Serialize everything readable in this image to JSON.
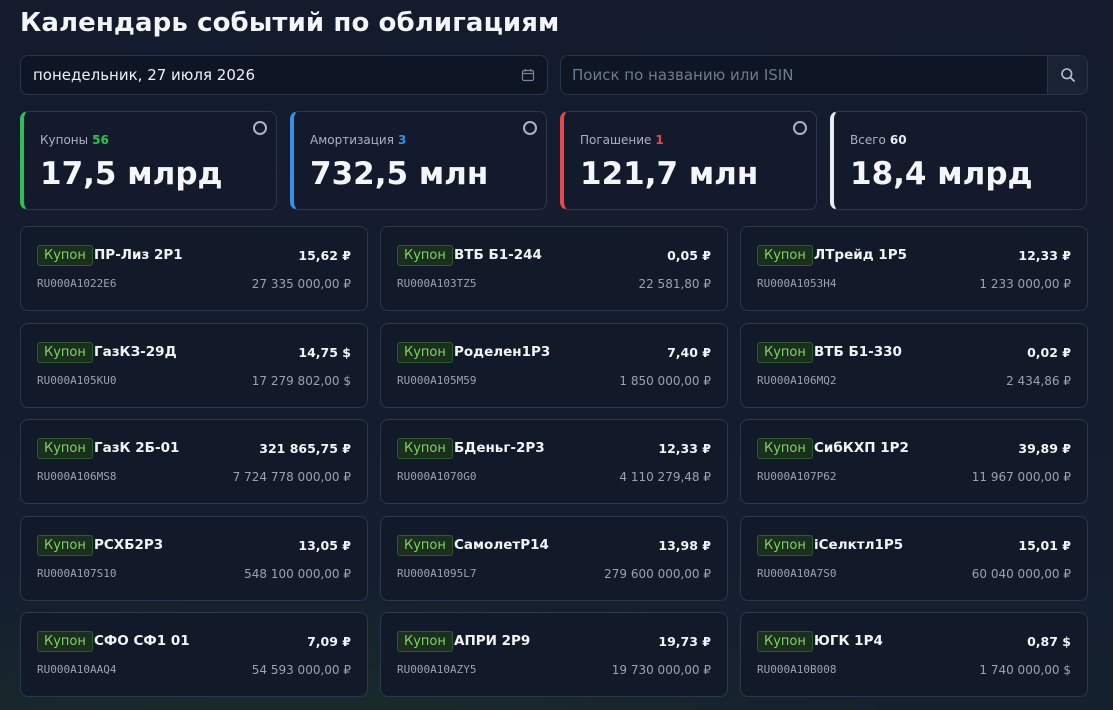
{
  "title": "Календарь событий по облигациям",
  "date_field": {
    "value": "понедельник, 27 июля 2026",
    "icon": "calendar-icon"
  },
  "search": {
    "placeholder": "Поиск по названию или ISIN",
    "value": "",
    "icon": "search-icon"
  },
  "colors": {
    "coupons": "#2fbf5a",
    "amortization": "#3a8ee6",
    "redemption": "#e5484d",
    "total": "#e8ecf3",
    "badge_text": "#7fd06b"
  },
  "stats": [
    {
      "label": "Купоны",
      "count": "56",
      "value": "17,5 млрд"
    },
    {
      "label": "Амортизация",
      "count": "3",
      "value": "732,5 млн"
    },
    {
      "label": "Погашение",
      "count": "1",
      "value": "121,7 млн"
    },
    {
      "label": "Всего",
      "count": "60",
      "value": "18,4 млрд"
    }
  ],
  "cards": [
    {
      "badge": "Купон",
      "name": "ПР-Лиз 2P1",
      "amount": "15,62 ₽",
      "isin": "RU000A1022E6",
      "total": "27 335 000,00 ₽"
    },
    {
      "badge": "Купон",
      "name": "ВТБ Б1-244",
      "amount": "0,05 ₽",
      "isin": "RU000A103TZ5",
      "total": "22 581,80 ₽"
    },
    {
      "badge": "Купон",
      "name": "ЛТрейд 1Р5",
      "amount": "12,33 ₽",
      "isin": "RU000A1053H4",
      "total": "1 233 000,00 ₽"
    },
    {
      "badge": "Купон",
      "name": "ГазКЗ-29Д",
      "amount": "14,75 $",
      "isin": "RU000A105KU0",
      "total": "17 279 802,00 $"
    },
    {
      "badge": "Купон",
      "name": "Роделен1Р3",
      "amount": "7,40 ₽",
      "isin": "RU000A105M59",
      "total": "1 850 000,00 ₽"
    },
    {
      "badge": "Купон",
      "name": "ВТБ Б1-330",
      "amount": "0,02 ₽",
      "isin": "RU000A106MQ2",
      "total": "2 434,86 ₽"
    },
    {
      "badge": "Купон",
      "name": "ГазК 2Б-01",
      "amount": "321 865,75 ₽",
      "isin": "RU000A106MS8",
      "total": "7 724 778 000,00 ₽"
    },
    {
      "badge": "Купон",
      "name": "БДеньг-2Р3",
      "amount": "12,33 ₽",
      "isin": "RU000A1070G0",
      "total": "4 110 279,48 ₽"
    },
    {
      "badge": "Купон",
      "name": "СибКХП 1Р2",
      "amount": "39,89 ₽",
      "isin": "RU000A107P62",
      "total": "11 967 000,00 ₽"
    },
    {
      "badge": "Купон",
      "name": "РСХБ2Р3",
      "amount": "13,05 ₽",
      "isin": "RU000A107S10",
      "total": "548 100 000,00 ₽"
    },
    {
      "badge": "Купон",
      "name": "СамолетР14",
      "amount": "13,98 ₽",
      "isin": "RU000A1095L7",
      "total": "279 600 000,00 ₽"
    },
    {
      "badge": "Купон",
      "name": "iСелктл1Р5",
      "amount": "15,01 ₽",
      "isin": "RU000A10A7S0",
      "total": "60 040 000,00 ₽"
    },
    {
      "badge": "Купон",
      "name": "СФО СФ1 01",
      "amount": "7,09 ₽",
      "isin": "RU000A10AAQ4",
      "total": "54 593 000,00 ₽"
    },
    {
      "badge": "Купон",
      "name": "АПРИ 2Р9",
      "amount": "19,73 ₽",
      "isin": "RU000A10AZY5",
      "total": "19 730 000,00 ₽"
    },
    {
      "badge": "Купон",
      "name": "ЮГК 1Р4",
      "amount": "0,87 $",
      "isin": "RU000A10B008",
      "total": "1 740 000,00 $"
    }
  ]
}
